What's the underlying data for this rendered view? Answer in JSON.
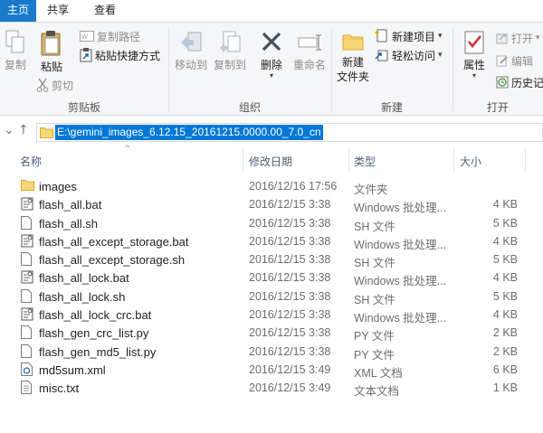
{
  "tabs": [
    {
      "label": "主页"
    },
    {
      "label": "共享"
    },
    {
      "label": "查看"
    }
  ],
  "ribbon": {
    "clipboard": {
      "group_label": "剪贴板",
      "copy": "复制",
      "paste": "粘贴",
      "copy_path": "复制路径",
      "paste_shortcut": "粘贴快捷方式",
      "cut": "剪切"
    },
    "organize": {
      "group_label": "组织",
      "move_to": "移动到",
      "copy_to": "复制到",
      "delete": "删除",
      "rename": "重命名"
    },
    "new": {
      "group_label": "新建",
      "new_folder": "新建\n文件夹",
      "new_folder_line1": "新建",
      "new_folder_line2": "文件夹",
      "new_item": "新建项目",
      "easy_access": "轻松访问"
    },
    "open": {
      "group_label": "打开",
      "properties": "属性",
      "open": "打开",
      "edit": "编辑",
      "history": "历史记"
    }
  },
  "address": {
    "path": "E:\\gemini_images_6.12.15_20161215.0000.00_7.0_cn"
  },
  "columns": {
    "name": "名称",
    "date": "修改日期",
    "type": "类型",
    "size": "大小"
  },
  "files": [
    {
      "name": "images",
      "date": "2016/12/16 17:56",
      "type": "文件夹",
      "size": "",
      "icon": "folder-icon"
    },
    {
      "name": "flash_all.bat",
      "date": "2016/12/15 3:38",
      "type": "Windows 批处理...",
      "size": "4 KB",
      "icon": "bat-file-icon"
    },
    {
      "name": "flash_all.sh",
      "date": "2016/12/15 3:38",
      "type": "SH 文件",
      "size": "5 KB",
      "icon": "file-icon"
    },
    {
      "name": "flash_all_except_storage.bat",
      "date": "2016/12/15 3:38",
      "type": "Windows 批处理...",
      "size": "4 KB",
      "icon": "bat-file-icon"
    },
    {
      "name": "flash_all_except_storage.sh",
      "date": "2016/12/15 3:38",
      "type": "SH 文件",
      "size": "5 KB",
      "icon": "file-icon"
    },
    {
      "name": "flash_all_lock.bat",
      "date": "2016/12/15 3:38",
      "type": "Windows 批处理...",
      "size": "4 KB",
      "icon": "bat-file-icon"
    },
    {
      "name": "flash_all_lock.sh",
      "date": "2016/12/15 3:38",
      "type": "SH 文件",
      "size": "5 KB",
      "icon": "file-icon"
    },
    {
      "name": "flash_all_lock_crc.bat",
      "date": "2016/12/15 3:38",
      "type": "Windows 批处理...",
      "size": "4 KB",
      "icon": "bat-file-icon"
    },
    {
      "name": "flash_gen_crc_list.py",
      "date": "2016/12/15 3:38",
      "type": "PY 文件",
      "size": "2 KB",
      "icon": "file-icon"
    },
    {
      "name": "flash_gen_md5_list.py",
      "date": "2016/12/15 3:38",
      "type": "PY 文件",
      "size": "2 KB",
      "icon": "file-icon"
    },
    {
      "name": "md5sum.xml",
      "date": "2016/12/15 3:49",
      "type": "XML 文档",
      "size": "6 KB",
      "icon": "xml-file-icon"
    },
    {
      "name": "misc.txt",
      "date": "2016/12/15 3:49",
      "type": "文本文档",
      "size": "1 KB",
      "icon": "text-file-icon"
    }
  ],
  "colors": {
    "accent": "#1979ca",
    "selection": "#0078d7",
    "folder": "#f8d775"
  }
}
